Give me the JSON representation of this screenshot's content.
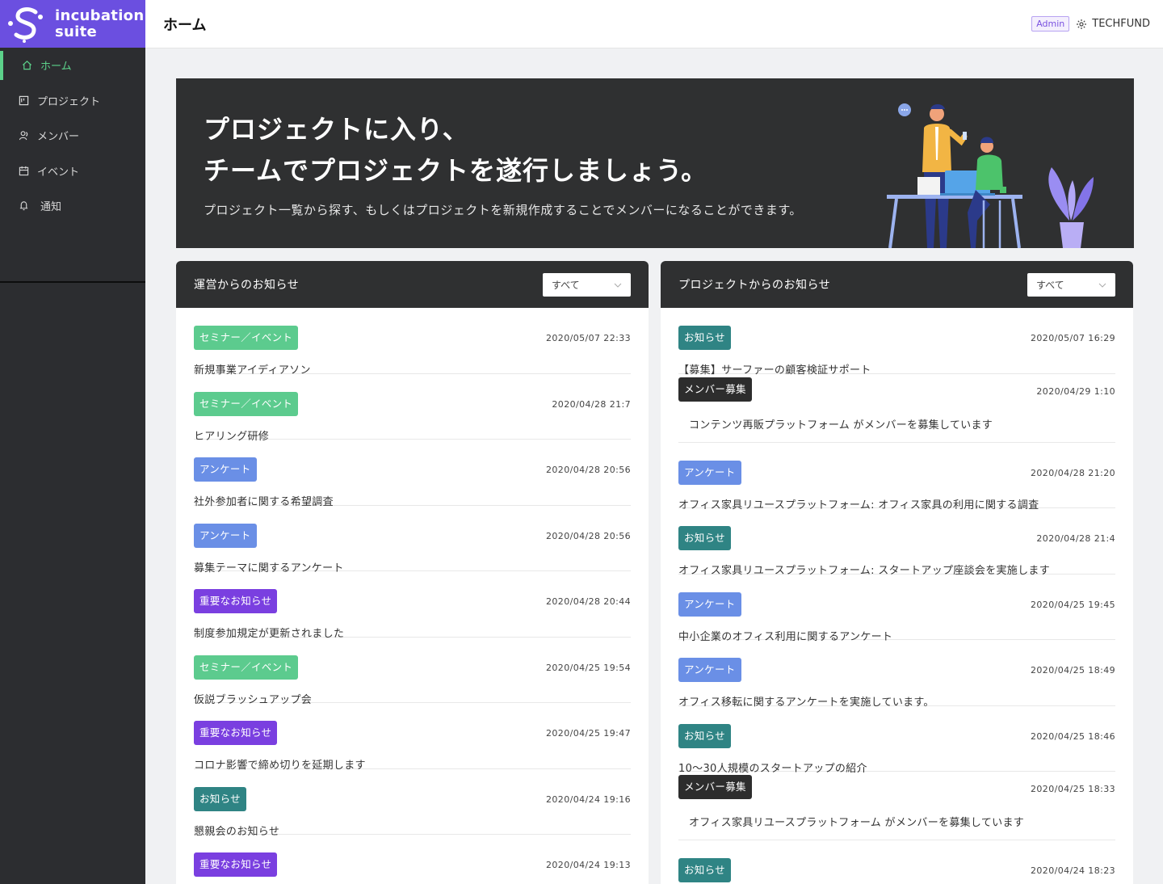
{
  "brand": {
    "line1": "incubation",
    "line2": "suite"
  },
  "sidebar": {
    "items": [
      {
        "label": "ホーム",
        "icon": "home-icon",
        "active": true
      },
      {
        "label": "プロジェクト",
        "icon": "project-icon"
      },
      {
        "label": "メンバー",
        "icon": "members-icon"
      },
      {
        "label": "イベント",
        "icon": "calendar-icon"
      },
      {
        "label": "通知",
        "icon": "bell-icon"
      }
    ]
  },
  "header": {
    "title": "ホーム",
    "role_badge": "Admin",
    "org": "TECHFUND"
  },
  "hero": {
    "title_line1": "プロジェクトに入り、",
    "title_line2": "チームでプロジェクトを遂行しましょう。",
    "subtitle": "プロジェクト一覧から探す、もしくはプロジェクトを新規作成することでメンバーになることができます。"
  },
  "colors": {
    "seminar": "#5ccb8e",
    "survey": "#6a8fe6",
    "important": "#7a3fe0",
    "notice": "#2f8484",
    "recruit": "#2d2d2d"
  },
  "admin_panel": {
    "title": "運営からのお知らせ",
    "filter": "すべて",
    "items": [
      {
        "tag": "セミナー／イベント",
        "kind": "seminar",
        "date": "2020/05/07 22:33",
        "title": "新規事業アイディアソン"
      },
      {
        "tag": "セミナー／イベント",
        "kind": "seminar",
        "date": "2020/04/28 21:7",
        "title": "ヒアリング研修"
      },
      {
        "tag": "アンケート",
        "kind": "survey",
        "date": "2020/04/28 20:56",
        "title": "社外参加者に関する希望調査"
      },
      {
        "tag": "アンケート",
        "kind": "survey",
        "date": "2020/04/28 20:56",
        "title": "募集テーマに関するアンケート"
      },
      {
        "tag": "重要なお知らせ",
        "kind": "important",
        "date": "2020/04/28 20:44",
        "title": "制度参加規定が更新されました"
      },
      {
        "tag": "セミナー／イベント",
        "kind": "seminar",
        "date": "2020/04/25 19:54",
        "title": "仮説ブラッシュアップ会"
      },
      {
        "tag": "重要なお知らせ",
        "kind": "important",
        "date": "2020/04/25 19:47",
        "title": "コロナ影響で締め切りを延期します"
      },
      {
        "tag": "お知らせ",
        "kind": "notice",
        "date": "2020/04/24 19:16",
        "title": "懇親会のお知らせ"
      },
      {
        "tag": "重要なお知らせ",
        "kind": "important",
        "date": "2020/04/24 19:13",
        "title": ""
      }
    ]
  },
  "project_panel": {
    "title": "プロジェクトからのお知らせ",
    "filter": "すべて",
    "items": [
      {
        "tag": "お知らせ",
        "kind": "notice",
        "date": "2020/05/07 16:29",
        "title": "【募集】サーファーの顧客検証サポート"
      },
      {
        "tag": "メンバー募集",
        "kind": "recruit",
        "date": "2020/04/29 1:10",
        "title": "コンテンツ再販プラットフォーム がメンバーを募集しています"
      },
      {
        "tag": "アンケート",
        "kind": "survey",
        "date": "2020/04/28 21:20",
        "title": "オフィス家具リユースプラットフォーム: オフィス家具の利用に関する調査"
      },
      {
        "tag": "お知らせ",
        "kind": "notice",
        "date": "2020/04/28 21:4",
        "title": "オフィス家具リユースプラットフォーム: スタートアップ座談会を実施します"
      },
      {
        "tag": "アンケート",
        "kind": "survey",
        "date": "2020/04/25 19:45",
        "title": "中小企業のオフィス利用に関するアンケート"
      },
      {
        "tag": "アンケート",
        "kind": "survey",
        "date": "2020/04/25 18:49",
        "title": "オフィス移転に関するアンケートを実施しています。"
      },
      {
        "tag": "お知らせ",
        "kind": "notice",
        "date": "2020/04/25 18:46",
        "title": "10〜30人規模のスタートアップの紹介"
      },
      {
        "tag": "メンバー募集",
        "kind": "recruit",
        "date": "2020/04/25 18:33",
        "title": "オフィス家具リユースプラットフォーム がメンバーを募集しています"
      },
      {
        "tag": "お知らせ",
        "kind": "notice",
        "date": "2020/04/24 18:23",
        "title": ""
      }
    ]
  }
}
